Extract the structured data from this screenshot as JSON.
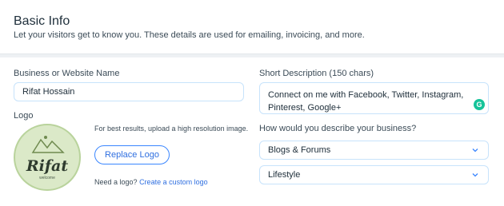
{
  "header": {
    "title": "Basic Info",
    "subtitle": "Let your visitors get to know you. These details are used for emailing, invoicing, and more."
  },
  "business_name": {
    "label": "Business or Website Name",
    "value": "Rifat Hossain"
  },
  "short_description": {
    "label": "Short Description (150 chars)",
    "line1": "Connect on me with Facebook, Twitter, Instagram,",
    "line2": "Pinterest, Google+"
  },
  "logo": {
    "label": "Logo",
    "brand_text": "Rifat",
    "brand_sub": "welcome",
    "hint": "For best results, upload a high resolution image.",
    "replace_button": "Replace Logo",
    "need_logo_text": "Need a logo?",
    "create_link": "Create a custom logo"
  },
  "business_type": {
    "question": "How would you describe your business?",
    "category": "Blogs & Forums",
    "subcategory": "Lifestyle"
  },
  "icons": {
    "grammarly": "grammarly-icon",
    "chevron": "chevron-down-icon"
  },
  "colors": {
    "accent": "#3a86ff",
    "input_border": "#c7e3fb",
    "grammarly": "#15c39a"
  }
}
